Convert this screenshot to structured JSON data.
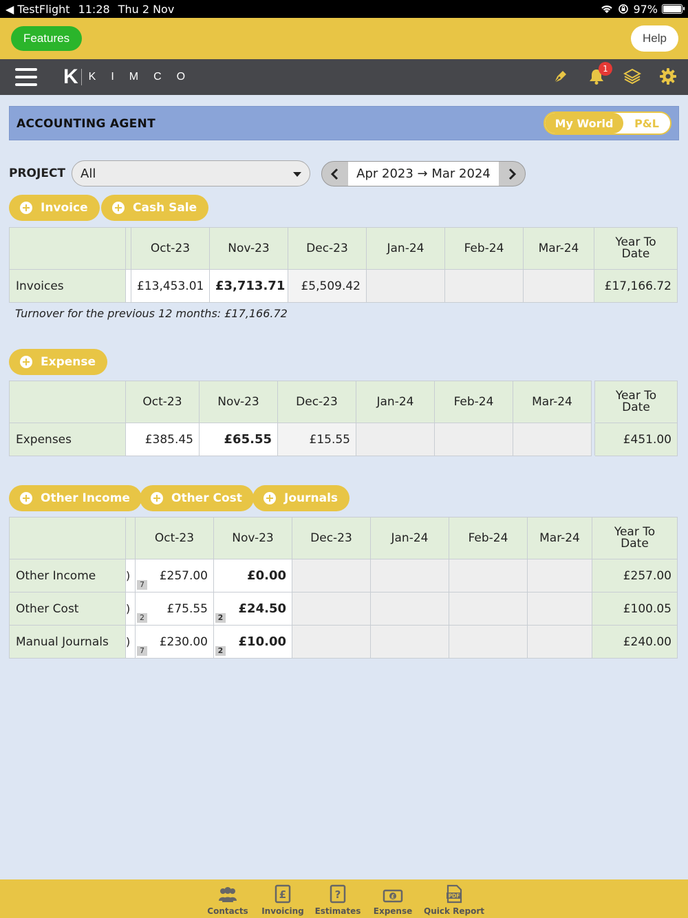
{
  "statusbar": {
    "back_app": "TestFlight",
    "time": "11:28",
    "date": "Thu 2 Nov",
    "battery": "97%"
  },
  "topbar": {
    "features_label": "Features",
    "help_label": "Help"
  },
  "navbar": {
    "logo_letter": "K",
    "logo_word": "KIMCO",
    "notification_count": "1"
  },
  "header": {
    "title": "ACCOUNTING AGENT",
    "toggle_active": "My World",
    "toggle_inactive": "P&L"
  },
  "filter": {
    "project_label": "PROJECT",
    "project_value": "All",
    "date_range": "Apr 2023 → Mar 2024"
  },
  "months": [
    "Oct-23",
    "Nov-23",
    "Dec-23",
    "Jan-24",
    "Feb-24",
    "Mar-24"
  ],
  "ytd_label_1": "Year To",
  "ytd_label_2": "Date",
  "invoices": {
    "buttons": [
      "Invoice",
      "Cash Sale"
    ],
    "row_label": "Invoices",
    "values": [
      "£13,453.01",
      "£3,713.71",
      "£5,509.42",
      "",
      "",
      ""
    ],
    "ytd": "£17,166.72",
    "turnover_note": "Turnover for the previous 12 months: £17,166.72"
  },
  "expenses": {
    "buttons": [
      "Expense"
    ],
    "row_label": "Expenses",
    "values": [
      "£385.45",
      "£65.55",
      "£15.55",
      "",
      "",
      ""
    ],
    "ytd": "£451.00"
  },
  "other": {
    "buttons": [
      "Other Income",
      "Other Cost",
      "Journals"
    ],
    "rows": [
      {
        "label": "Other Income",
        "sliver": ")",
        "values": [
          "£257.00",
          "£0.00"
        ],
        "counts": [
          "7",
          ""
        ],
        "ytd": "£257.00"
      },
      {
        "label": "Other Cost",
        "sliver": ")",
        "values": [
          "£75.55",
          "£24.50"
        ],
        "counts": [
          "2",
          "2"
        ],
        "ytd": "£100.05"
      },
      {
        "label": "Manual Journals",
        "sliver": ")",
        "values": [
          "£230.00",
          "£10.00"
        ],
        "counts": [
          "7",
          "2"
        ],
        "ytd": "£240.00"
      }
    ]
  },
  "tabs": [
    "Contacts",
    "Invoicing",
    "Estimates",
    "Expense",
    "Quick Report"
  ],
  "colors": {
    "accent": "#e8c545",
    "green": "#2bb52b",
    "nav": "#46474b",
    "header_blue": "#8aa4d8",
    "cell_green": "#e2eedb"
  }
}
